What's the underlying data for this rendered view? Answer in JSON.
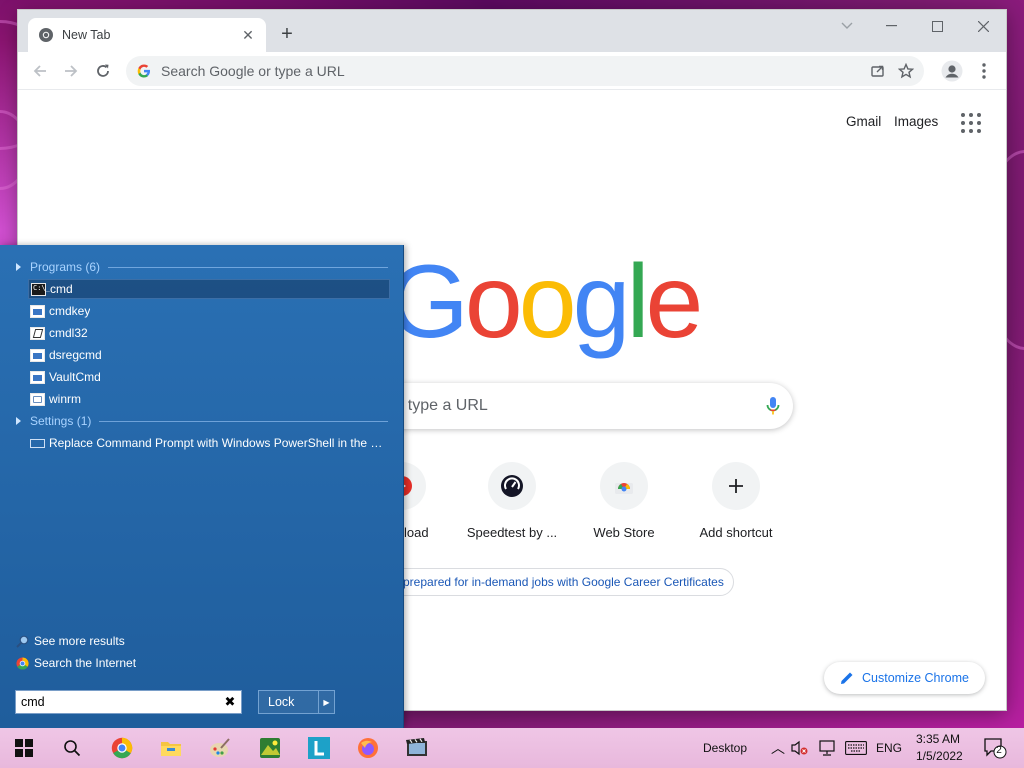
{
  "browser": {
    "tab_title": "New Tab",
    "omnibox_placeholder": "Search Google or type a URL"
  },
  "ntp": {
    "links": {
      "gmail": "Gmail",
      "images": "Images"
    },
    "logo_letters": [
      "G",
      "o",
      "o",
      "g",
      "l",
      "e"
    ],
    "logo_colors": [
      "#4285f4",
      "#ea4335",
      "#fbbc05",
      "#4285f4",
      "#34a853",
      "#ea4335"
    ],
    "search_placeholder_visible": "r type a URL",
    "shortcuts": [
      {
        "label": "load",
        "icon": "youtube-icon"
      },
      {
        "label": "Speedtest by ...",
        "icon": "speedtest-icon"
      },
      {
        "label": "Web Store",
        "icon": "web-store-icon"
      },
      {
        "label": "Add shortcut",
        "icon": "plus-icon"
      }
    ],
    "promo": "prepared for in-demand jobs with Google Career Certificates",
    "customize": "Customize Chrome"
  },
  "start_menu": {
    "programs_header": "Programs (6)",
    "programs": [
      {
        "name": "cmd",
        "icon": "command-prompt-icon",
        "selected": true
      },
      {
        "name": "cmdkey",
        "icon": "program-icon",
        "selected": false
      },
      {
        "name": "cmdl32",
        "icon": "cmdl32-icon",
        "selected": false
      },
      {
        "name": "dsregcmd",
        "icon": "program-icon",
        "selected": false
      },
      {
        "name": "VaultCmd",
        "icon": "program-icon",
        "selected": false
      },
      {
        "name": "winrm",
        "icon": "winrm-icon",
        "selected": false
      }
    ],
    "settings_header": "Settings (1)",
    "settings": [
      {
        "name": "Replace Command Prompt with Windows PowerShell in the W...",
        "icon": "settings-icon"
      }
    ],
    "see_more": "See more results",
    "search_internet": "Search the Internet",
    "search_value": "cmd",
    "lock_label": "Lock"
  },
  "taskbar": {
    "apps": [
      "chrome-icon",
      "file-explorer-icon",
      "paint-icon",
      "image-viewer-icon",
      "l-app-icon",
      "firefox-icon",
      "video-editor-icon"
    ],
    "desktop_label": "Desktop",
    "language": "ENG",
    "time": "3:35 AM",
    "date": "1/5/2022",
    "notification_count": "2"
  }
}
